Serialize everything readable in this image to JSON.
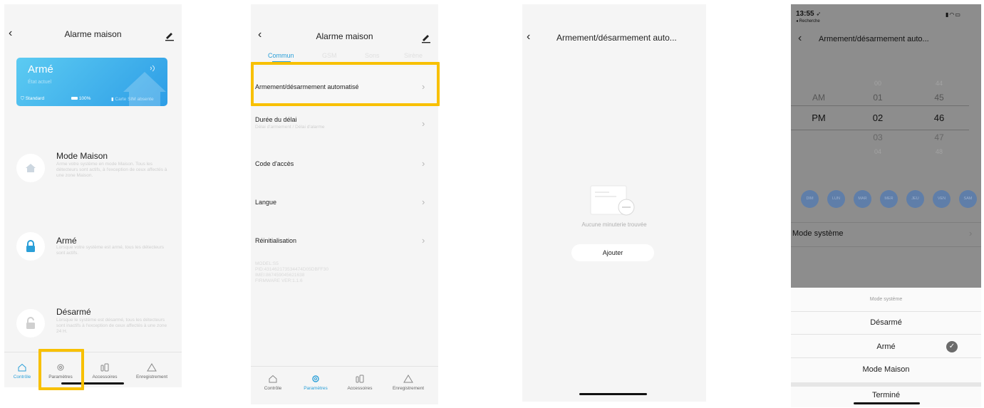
{
  "colors": {
    "accent": "#2a9fd8",
    "highlight": "#f8c000",
    "card_gradient_start": "#58c8f0",
    "card_gradient_end": "#2f9ee6",
    "dim_overlay": "#8c8c8c"
  },
  "screen1": {
    "title": "Alarme maison",
    "card": {
      "status": "Armé",
      "substatus": "État actuel",
      "standard": "Standard",
      "battery": "100%",
      "sim": "Carte SIM absente"
    },
    "modes": [
      {
        "title": "Mode Maison",
        "desc": "Arme votre système en mode Maison. Tous les détecteurs sont actifs, à l'exception de ceux affectés à une zone Maison.",
        "icon": "home-icon"
      },
      {
        "title": "Armé",
        "desc": "Lorsque votre système est armé, tous les détecteurs sont actifs.",
        "icon": "lock-icon"
      },
      {
        "title": "Désarmé",
        "desc": "Lorsque le système est désarmé, tous les détecteurs sont inactifs à l'exception de ceux affectés à une zone 24 H.",
        "icon": "unlock-icon"
      }
    ],
    "tabbar": [
      "Contrôle",
      "Paramètres",
      "Accessoires",
      "Enregistrement"
    ]
  },
  "screen2": {
    "title": "Alarme maison",
    "tabs": [
      "Commun",
      "GSM",
      "Sons",
      "Sirène"
    ],
    "rows": [
      {
        "label": "Armement/désarmement automatisé",
        "sub": ""
      },
      {
        "label": "Durée du délai",
        "sub": "Délai d'armement / Délai d'alarme"
      },
      {
        "label": "Code d'accès",
        "sub": ""
      },
      {
        "label": "Langue",
        "sub": ""
      },
      {
        "label": "Réinitialisation",
        "sub": ""
      }
    ],
    "info": [
      "MODEL:S5",
      "PID:431462173534474D05DBFF30",
      "IMEI:867459045621638",
      "FIRMWARE VER:1.1.6"
    ],
    "tabbar": [
      "Contrôle",
      "Paramètres",
      "Accessoires",
      "Enregistrement"
    ]
  },
  "screen3": {
    "title": "Armement/désarmement auto...",
    "empty_text": "Aucune minuterie trouvée",
    "add_button": "Ajouter"
  },
  "screen4": {
    "status_time": "13:55",
    "status_back": "◂ Recherche",
    "title": "Armement/désarmement auto...",
    "ampm": [
      "AM",
      "PM"
    ],
    "hours": [
      "00",
      "01",
      "02",
      "03",
      "04"
    ],
    "minutes": [
      "44",
      "45",
      "46",
      "47",
      "48"
    ],
    "days": [
      "DIM",
      "LUN",
      "MAR",
      "MER",
      "JEU",
      "VEN",
      "SAM"
    ],
    "mode_row": "Mode système",
    "sheet": {
      "title": "Mode système",
      "options": [
        "Désarmé",
        "Armé",
        "Mode Maison"
      ],
      "selected": "Armé",
      "done": "Terminé"
    }
  }
}
